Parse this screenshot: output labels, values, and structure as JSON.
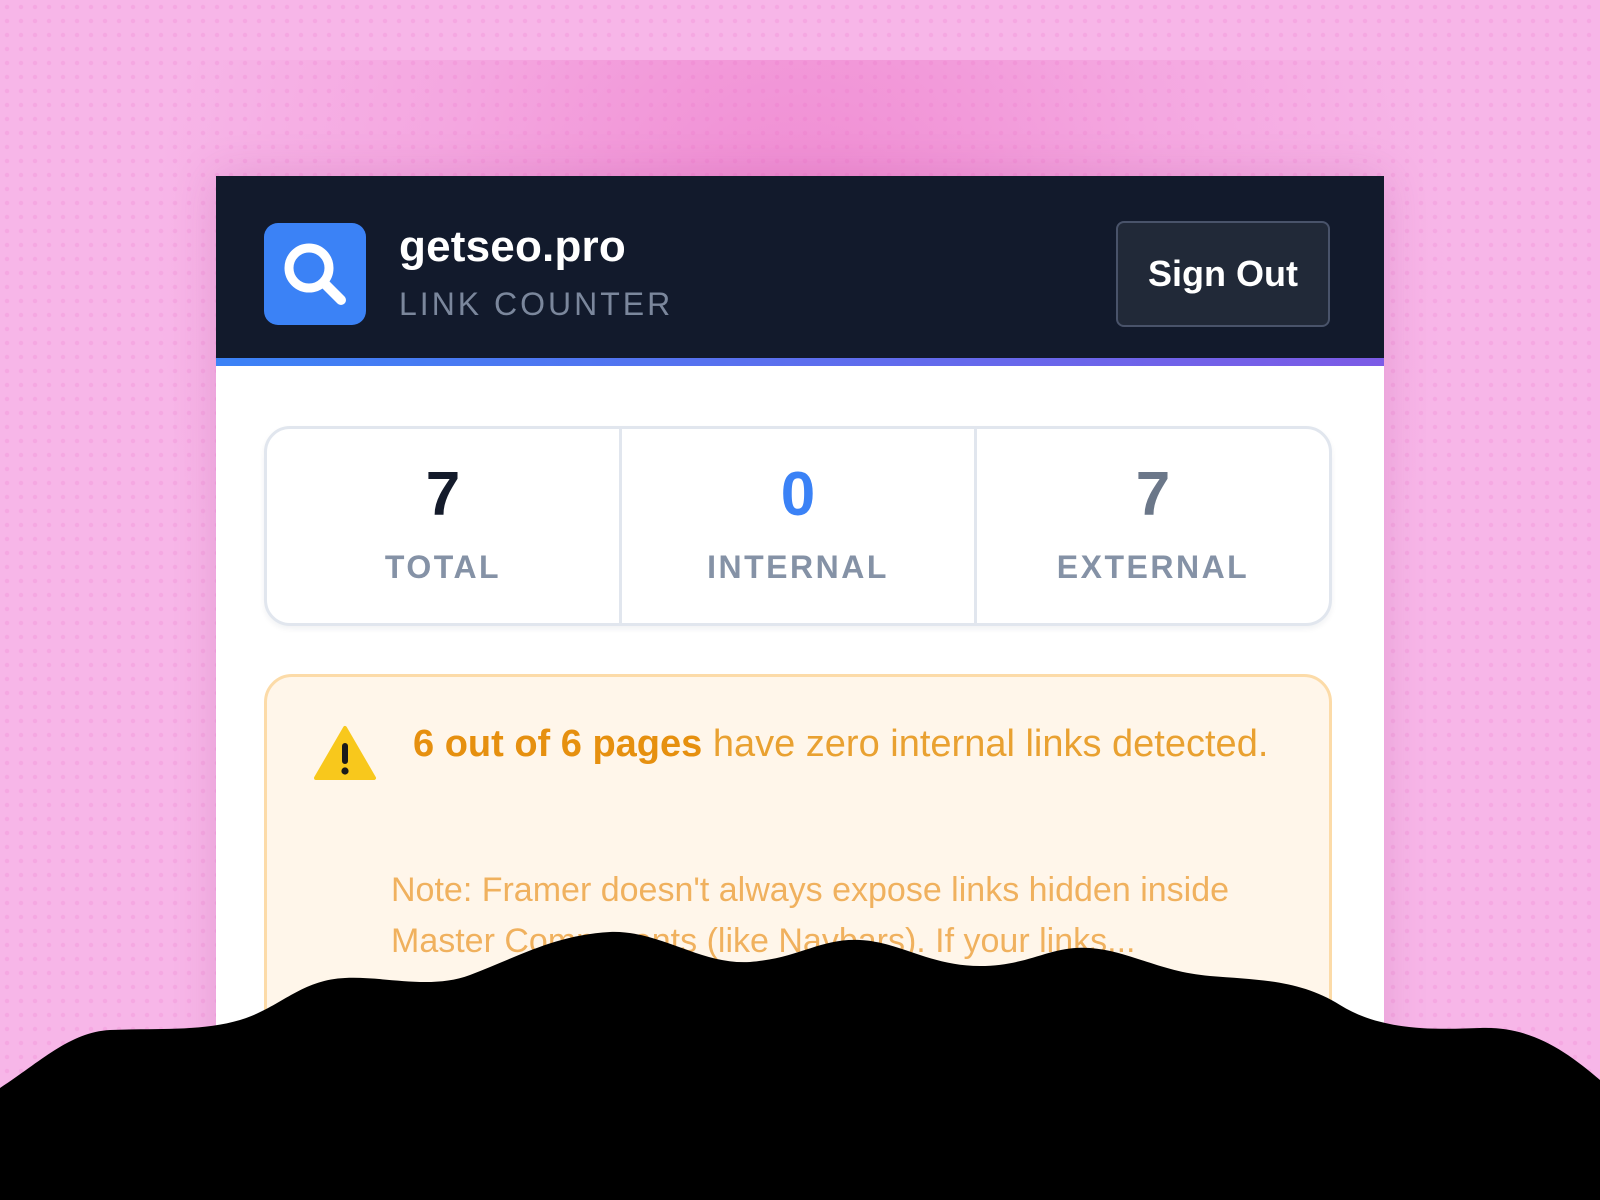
{
  "header": {
    "logo_icon": "search-icon",
    "app_name": "getseo.pro",
    "app_subtitle": "LINK COUNTER",
    "sign_out_label": "Sign Out"
  },
  "stats": {
    "total": {
      "value": "7",
      "label": "TOTAL"
    },
    "internal": {
      "value": "0",
      "label": "INTERNAL"
    },
    "external": {
      "value": "7",
      "label": "EXTERNAL"
    }
  },
  "alert": {
    "icon": "warning-icon",
    "highlight": "6 out of 6 pages",
    "message": " have zero internal links detected.",
    "note": "Note: Framer doesn't always expose links hidden inside Master Components (like Navbars). If your links..."
  },
  "colors": {
    "background": "#f7b6e8",
    "header_bg": "#121a2c",
    "accent_blue": "#3b82f6",
    "accent_purple": "#7c5be6",
    "warning_text": "#e6900f",
    "warning_bg": "#fff6ea"
  }
}
